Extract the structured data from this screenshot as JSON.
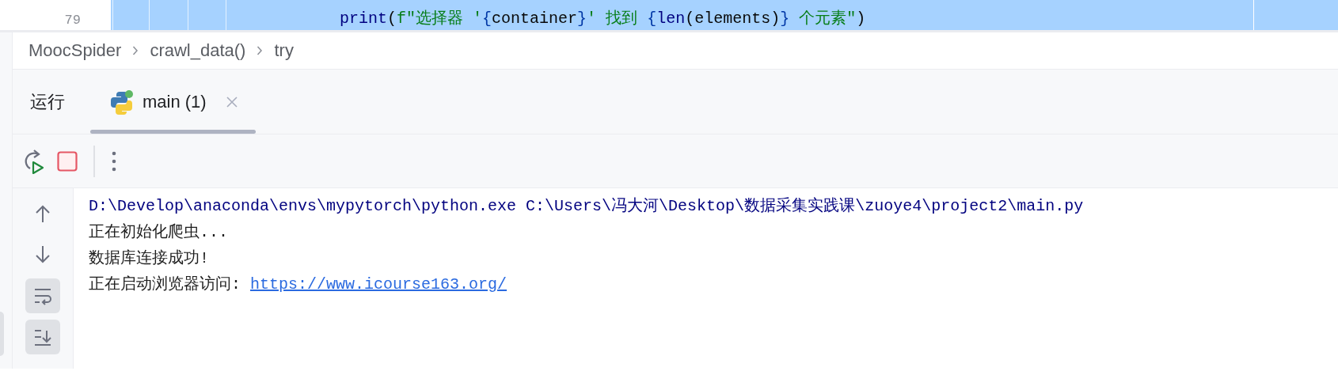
{
  "editor": {
    "lines": [
      {
        "number": "79",
        "selected": true,
        "tokens": [
          {
            "kind": "builtin",
            "text": "print"
          },
          {
            "kind": "plain",
            "text": "("
          },
          {
            "kind": "string",
            "text": "f\"选择器 '"
          },
          {
            "kind": "brace",
            "text": "{"
          },
          {
            "kind": "plain",
            "text": "container"
          },
          {
            "kind": "brace",
            "text": "}"
          },
          {
            "kind": "string",
            "text": "' 找到 "
          },
          {
            "kind": "brace",
            "text": "{"
          },
          {
            "kind": "builtin",
            "text": "len"
          },
          {
            "kind": "plain",
            "text": "(elements)"
          },
          {
            "kind": "brace",
            "text": "}"
          },
          {
            "kind": "string",
            "text": " 个元素\""
          },
          {
            "kind": "plain",
            "text": ")"
          }
        ]
      }
    ]
  },
  "breadcrumbs": [
    "MoocSpider",
    "crawl_data()",
    "try"
  ],
  "tool_window": {
    "title": "运行",
    "tabs": [
      {
        "label": "main (1)",
        "selected": true
      }
    ]
  },
  "side_toolbar": [
    {
      "kind": "up",
      "on": false
    },
    {
      "kind": "down",
      "on": false
    },
    {
      "kind": "soft_wrap",
      "on": true
    },
    {
      "kind": "scroll_to_end",
      "on": true
    }
  ],
  "console": {
    "lines": [
      {
        "kind": "command",
        "text": "D:\\Develop\\anaconda\\envs\\mypytorch\\python.exe C:\\Users\\冯大河\\Desktop\\数据采集实践课\\zuoye4\\project2\\main.py"
      },
      {
        "kind": "output",
        "text": "正在初始化爬虫..."
      },
      {
        "kind": "output",
        "text": "数据库连接成功!"
      },
      {
        "kind": "output",
        "text": "正在启动浏览器访问: ",
        "link": "https://www.icourse163.org/"
      }
    ]
  }
}
